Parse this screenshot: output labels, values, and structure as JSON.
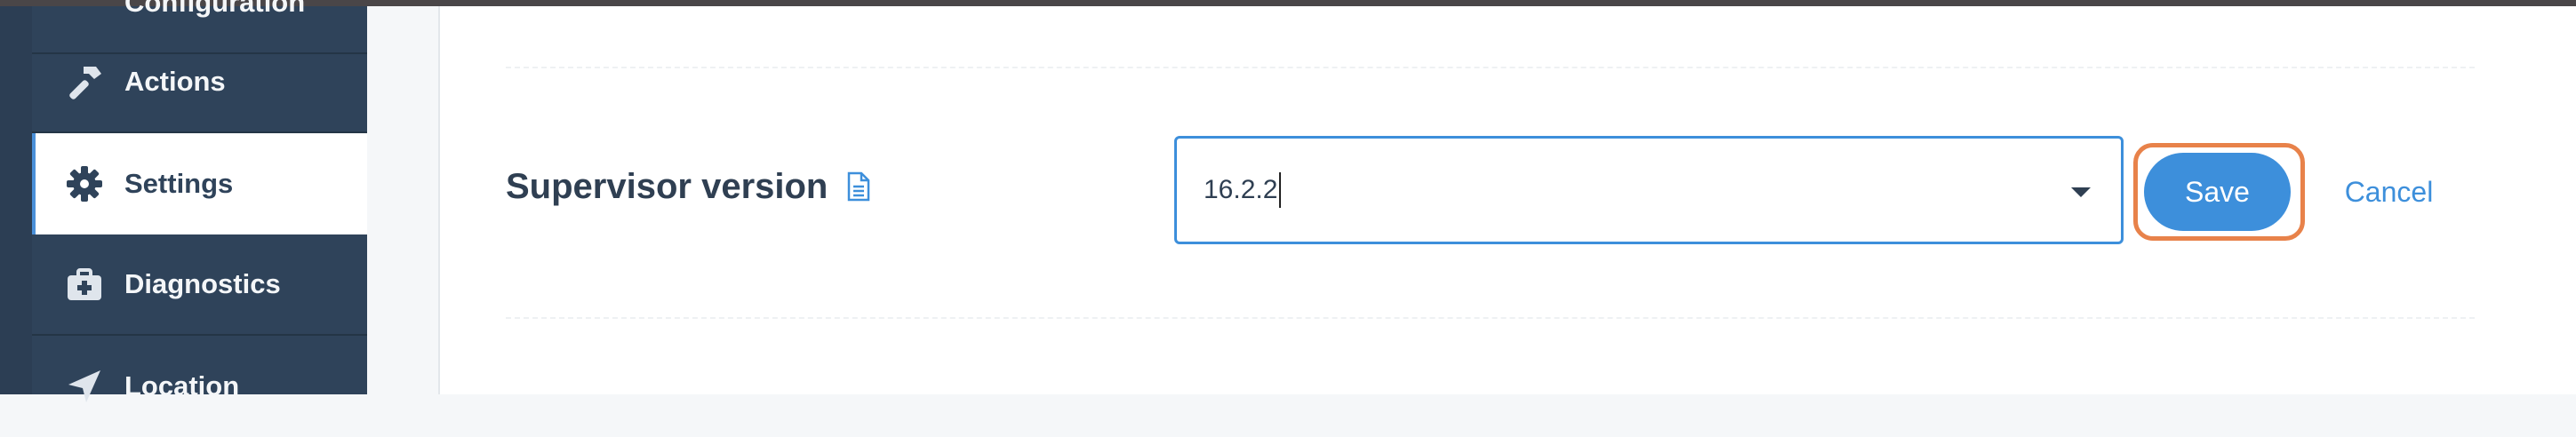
{
  "sidebar": {
    "items": [
      {
        "label": "Configuration",
        "icon": "sliders-icon"
      },
      {
        "label": "Actions",
        "icon": "hammer-icon"
      },
      {
        "label": "Settings",
        "icon": "gear-icon",
        "active": true
      },
      {
        "label": "Diagnostics",
        "icon": "medkit-icon"
      },
      {
        "label": "Location",
        "icon": "location-arrow-icon"
      }
    ]
  },
  "setting": {
    "label": "Supervisor version",
    "doc_icon": "document-icon",
    "select_value": "16.2.2",
    "save_label": "Save",
    "cancel_label": "Cancel"
  },
  "colors": {
    "sidebar_bg": "#2f435a",
    "accent": "#3d8fdb",
    "focus_ring": "#e8824a"
  }
}
